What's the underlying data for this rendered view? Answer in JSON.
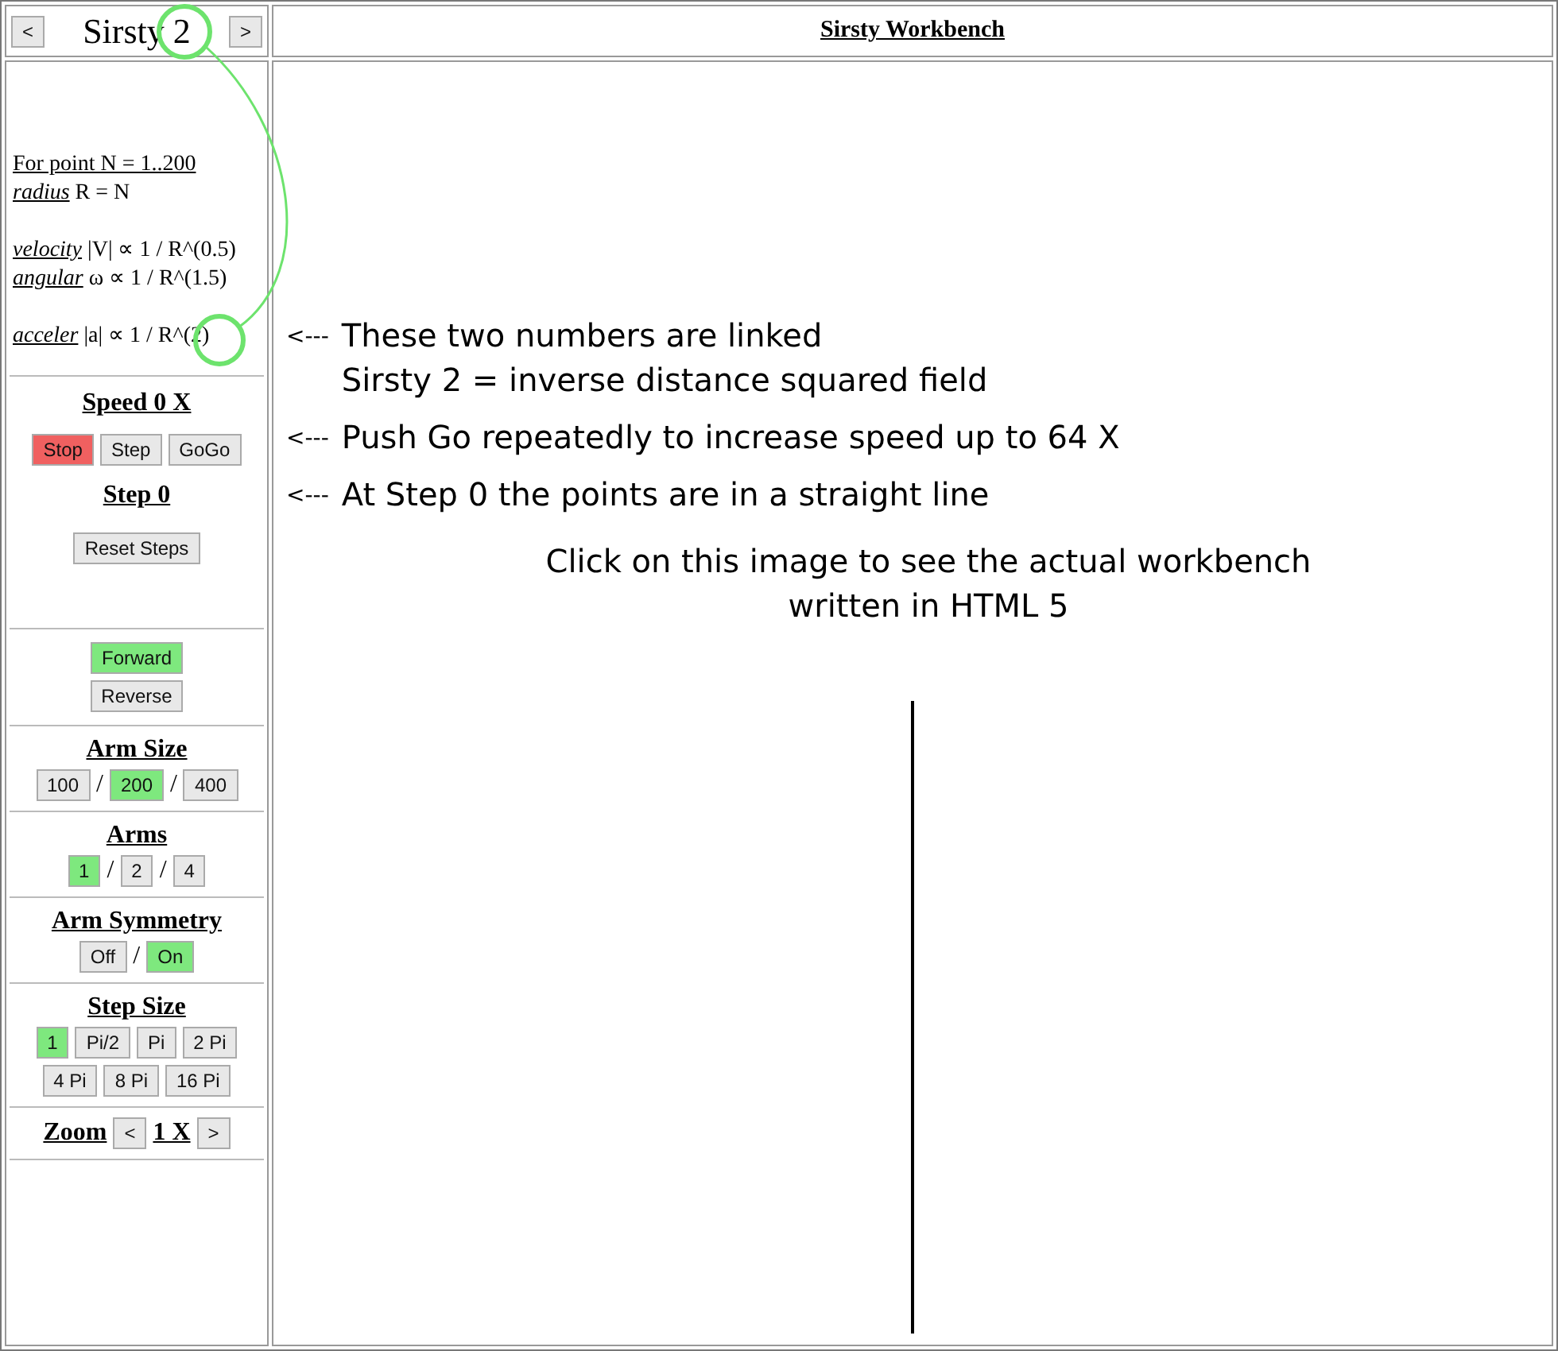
{
  "header": {
    "prev": "<",
    "title": "Sirsty 2",
    "next": ">",
    "workbench_title": "Sirsty Workbench"
  },
  "formula_groups": [
    [
      {
        "kind": "heading",
        "text": "For point N = 1..200"
      },
      {
        "kind": "term",
        "term": "radius",
        "text": "R = N"
      }
    ],
    [
      {
        "kind": "term",
        "term": "velocity",
        "text": "|V| ∝ 1 / R^(0.5)"
      },
      {
        "kind": "term",
        "term": "angular",
        "text": "ω ∝ 1 / R^(1.5)"
      }
    ],
    [
      {
        "kind": "term",
        "term": "acceler",
        "text": "|a| ∝ 1 / R^(2)"
      }
    ]
  ],
  "sections": [
    {
      "kind": "transport",
      "title": "Speed 0 X",
      "buttons": [
        {
          "label": "Stop",
          "selected": true
        },
        {
          "label": "Step",
          "selected": false
        },
        {
          "label": "GoGo",
          "selected": false
        }
      ],
      "counter": "Step 0",
      "reset": "Reset Steps"
    },
    {
      "kind": "stack",
      "buttons": [
        {
          "label": "Forward",
          "selected": true
        },
        {
          "label": "Reverse",
          "selected": false
        }
      ]
    },
    {
      "kind": "choice",
      "title": "Arm Size",
      "separator": "/",
      "buttons": [
        {
          "label": "100",
          "selected": false
        },
        {
          "label": "200",
          "selected": true
        },
        {
          "label": "400",
          "selected": false
        }
      ]
    },
    {
      "kind": "choice",
      "title": "Arms",
      "separator": "/",
      "buttons": [
        {
          "label": "1",
          "selected": true
        },
        {
          "label": "2",
          "selected": false
        },
        {
          "label": "4",
          "selected": false
        }
      ]
    },
    {
      "kind": "choice",
      "title": "Arm Symmetry",
      "separator": "/",
      "buttons": [
        {
          "label": "Off",
          "selected": false
        },
        {
          "label": "On",
          "selected": true
        }
      ]
    },
    {
      "kind": "choice",
      "title": "Step Size",
      "buttons": [
        {
          "label": "1",
          "selected": true
        },
        {
          "label": "Pi/2",
          "selected": false
        },
        {
          "label": "Pi",
          "selected": false
        },
        {
          "label": "2 Pi",
          "selected": false
        },
        {
          "label": "4 Pi",
          "selected": false
        },
        {
          "label": "8 Pi",
          "selected": false
        },
        {
          "label": "16 Pi",
          "selected": false
        }
      ]
    },
    {
      "kind": "zoom",
      "title": "Zoom",
      "prev": "<",
      "value": "1 X",
      "next": ">"
    }
  ],
  "annotations": [
    {
      "arrow": "<---",
      "lines": [
        "These two numbers are linked",
        "Sirsty 2 = inverse distance squared field"
      ]
    },
    {
      "arrow": "<---",
      "lines": [
        "Push Go repeatedly to increase speed up to 64 X"
      ]
    },
    {
      "arrow": "<---",
      "lines": [
        "At Step 0 the points are in a straight line"
      ]
    }
  ],
  "caption": [
    "Click on this image to see the actual workbench",
    "written in HTML 5"
  ]
}
